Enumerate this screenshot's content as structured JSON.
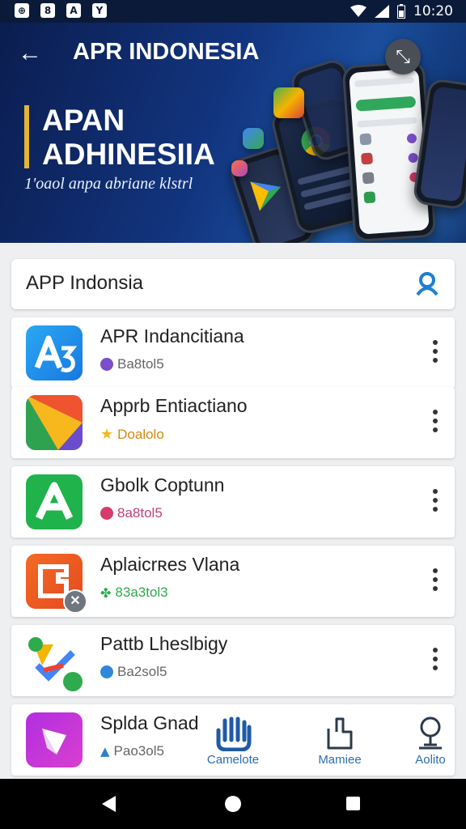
{
  "status_bar": {
    "time": "10:20",
    "left_icons": [
      "notification-icon-1",
      "notification-icon-2",
      "notification-icon-3",
      "notification-icon-4"
    ],
    "left_glyphs": [
      "⊕",
      "8",
      "A",
      "Y"
    ],
    "right_icons": [
      "wifi-icon",
      "signal-icon",
      "battery-icon"
    ]
  },
  "header": {
    "back_glyph": "←",
    "title": "APR INDONESIA",
    "hero_title": "APAN ADHINESIIA",
    "hero_subtitle": "1'oaol anpa abriane klstrl",
    "close_glyph": "⤡",
    "accent_color": "#e3b537"
  },
  "search": {
    "text": "APP Indonsia",
    "icon": "profile-search-icon",
    "icon_color": "#1e7fd0"
  },
  "apps": [
    {
      "name": "APR Indancitiana",
      "sub": "Ba8tol5",
      "icon": "app-a-blue-icon",
      "sub_icon": "purple-badge-icon",
      "sub_color": "#7a4fc9",
      "sub_text_color": "#666666"
    },
    {
      "name": "Apprb Entiactiano",
      "sub": "Doalolo",
      "icon": "app-triangle-icon",
      "sub_icon": "star-icon",
      "sub_color": "#f2b81f",
      "sub_text_color": "#d38a12"
    },
    {
      "name": "Gbolk Coptunn",
      "sub": "8a8tol5",
      "icon": "app-a-green-icon",
      "sub_icon": "pink-badge-icon",
      "sub_color": "#d63b6c",
      "sub_text_color": "#c0407a"
    },
    {
      "name": "Aplaicrʀes Vlana",
      "sub": "83a3tol3",
      "icon": "app-puzzle-icon",
      "sub_icon": "clover-icon",
      "sub_color": "#2faa4c",
      "sub_text_color": "#2faa4c"
    },
    {
      "name": "Pattb Lheslbigy",
      "sub": "Ba2sol5",
      "icon": "app-check-icon",
      "sub_icon": "blue-badge-icon",
      "sub_color": "#2e8ad8",
      "sub_text_color": "#666666"
    },
    {
      "name": "Splda Gnad",
      "sub": "Pao3ol5",
      "icon": "app-gem-icon",
      "sub_icon": "triangle-badge-icon",
      "sub_color": "#2e7fd0",
      "sub_text_color": "#666666"
    }
  ],
  "bottom_nav": [
    {
      "label": "Camelote",
      "icon": "hand-icon"
    },
    {
      "label": "Mamiee",
      "icon": "bag-icon"
    },
    {
      "label": "Aolito",
      "icon": "pin-icon"
    }
  ]
}
